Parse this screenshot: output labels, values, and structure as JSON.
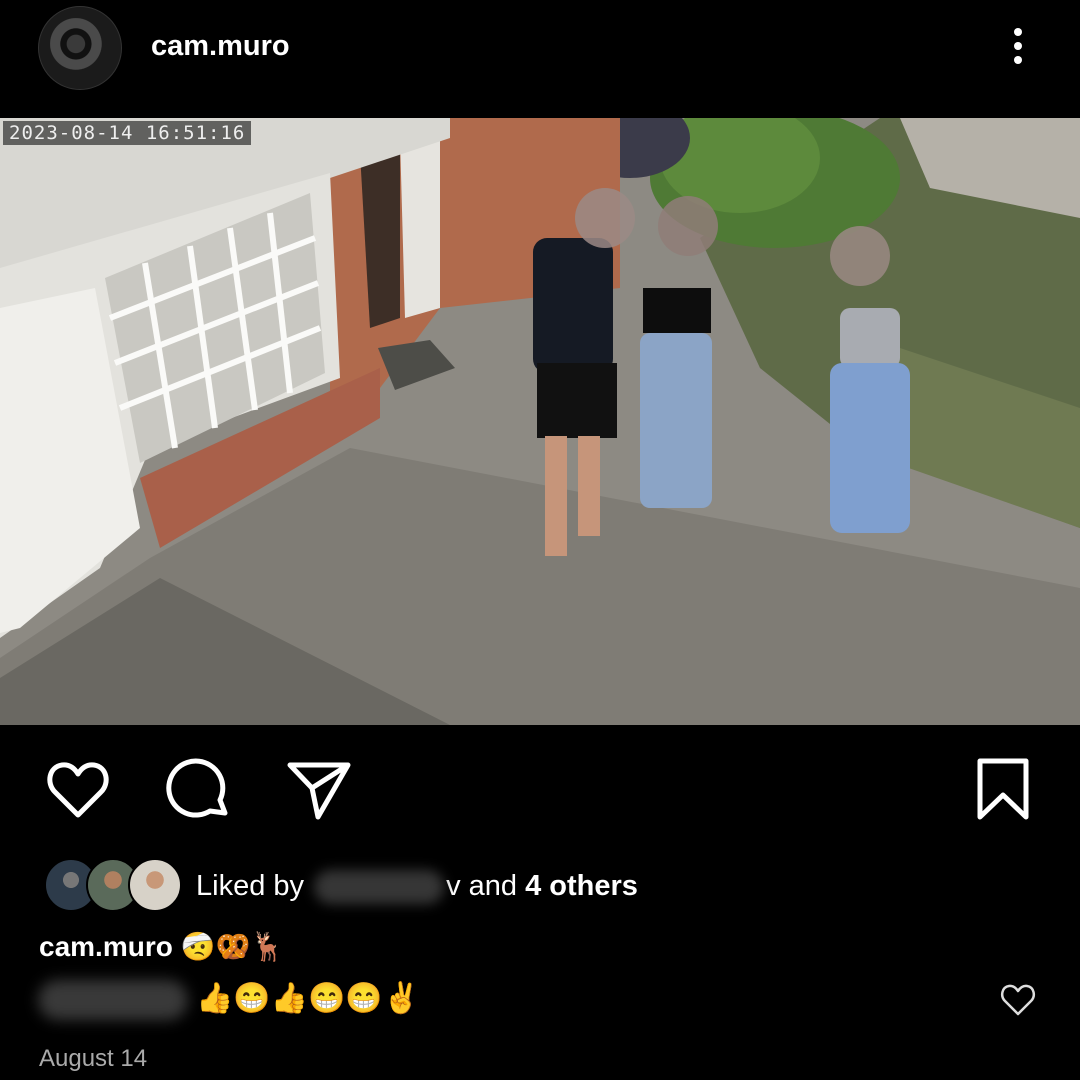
{
  "post": {
    "username": "cam.muro",
    "timestamp_overlay": "2023-08-14  16:51:16",
    "liked_by_prefix": "Liked by",
    "liked_by_suffix": "v and",
    "liked_by_others": "4 others",
    "caption_user": "cam.muro",
    "caption_text": "🤕🥨🦌",
    "comment_text": "👍😁👍😁😁✌️",
    "date": "August 14"
  },
  "icons": [
    "more-options-icon",
    "like-icon",
    "comment-icon",
    "share-icon",
    "save-icon",
    "comment-like-icon"
  ],
  "colors": {
    "background": "#000000",
    "text": "#ffffff",
    "muted": "#aaaaaa"
  }
}
